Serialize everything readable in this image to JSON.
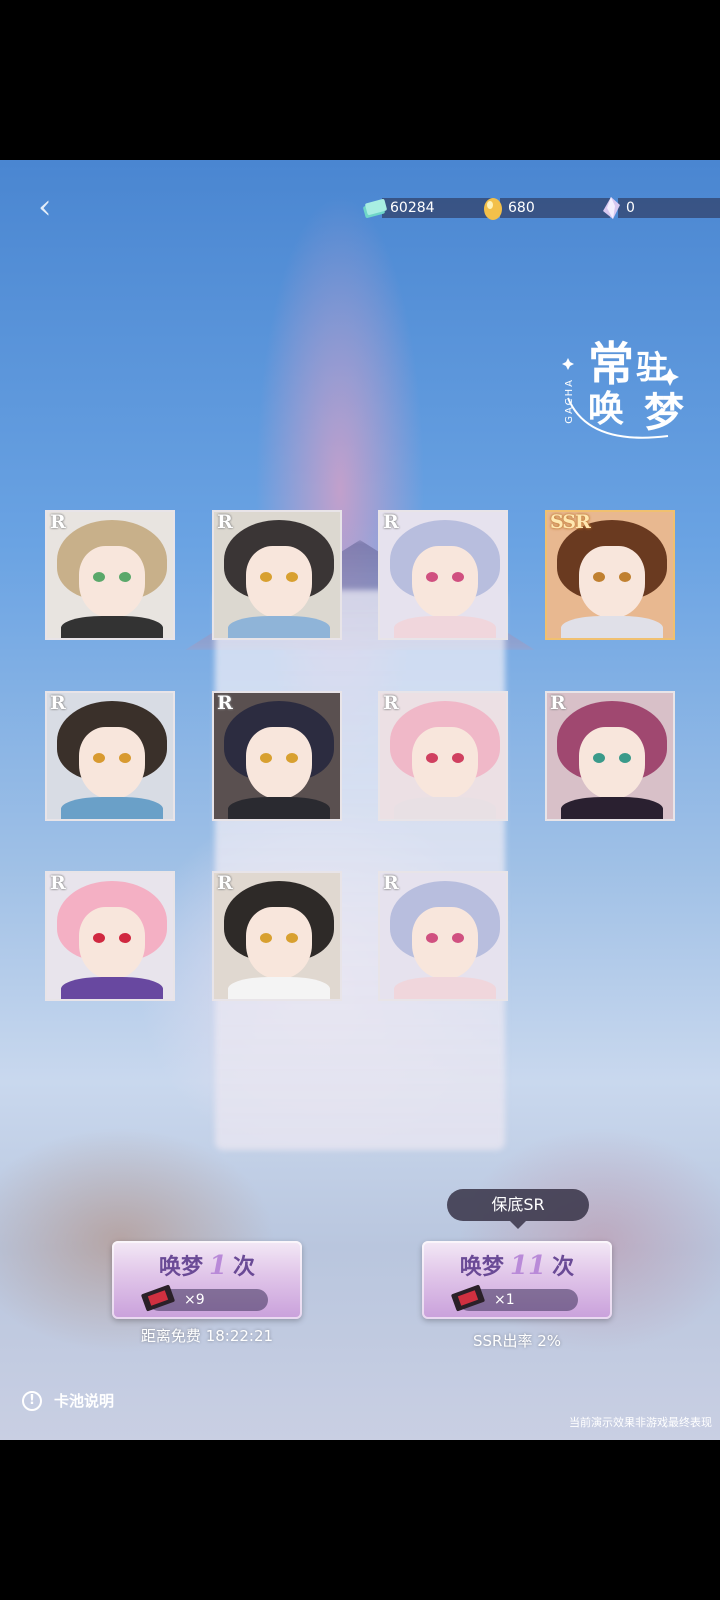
{
  "currencies": [
    {
      "icon": "ticket-stack-icon",
      "value": "60284",
      "color": "#6fd6c8"
    },
    {
      "icon": "gold-egg-icon",
      "value": "680",
      "color": "#f3c04a"
    },
    {
      "icon": "crystal-icon",
      "value": "0",
      "color": "#d8c8f0"
    }
  ],
  "banner": {
    "line1": "常",
    "line2": "驻",
    "line3": "唤",
    "line4": "梦",
    "tag": "GACHA"
  },
  "cards": [
    {
      "rarity": "R",
      "hair": "#c8b08a",
      "eye": "#5aa86a",
      "bg": "#e8e4e0",
      "body": "#333"
    },
    {
      "rarity": "R",
      "hair": "#3a3535",
      "eye": "#d8a030",
      "bg": "#dcd8d0",
      "body": "#8fb4d8"
    },
    {
      "rarity": "R",
      "hair": "#b8bede",
      "eye": "#d05080",
      "bg": "#e6e2ee",
      "body": "#f0d6dc"
    },
    {
      "rarity": "SSR",
      "hair": "#6a3a20",
      "eye": "#c08030",
      "bg": "#e8b890",
      "body": "#e0e0e8"
    },
    {
      "rarity": "R",
      "hair": "#3a302a",
      "eye": "#d89a30",
      "bg": "#d8dce4",
      "body": "#6aa0c8"
    },
    {
      "rarity": "R",
      "hair": "#2c2c40",
      "eye": "#d8a030",
      "bg": "#5a5050",
      "body": "#2a2a30"
    },
    {
      "rarity": "R",
      "hair": "#f0b8c8",
      "eye": "#d04060",
      "bg": "#ece0e4",
      "body": "#e8e0e4"
    },
    {
      "rarity": "R",
      "hair": "#a04870",
      "eye": "#3a9a8a",
      "bg": "#d8c0c8",
      "body": "#2a2030"
    },
    {
      "rarity": "R",
      "hair": "#f4b0c4",
      "eye": "#d02840",
      "bg": "#e8e4ec",
      "body": "#6848a0"
    },
    {
      "rarity": "R",
      "hair": "#2e2a28",
      "eye": "#d8a030",
      "bg": "#e0d8d0",
      "body": "#f4f4f4"
    },
    {
      "rarity": "R",
      "hair": "#b8bede",
      "eye": "#d05080",
      "bg": "#e6e2ee",
      "body": "#f0d6dc"
    }
  ],
  "pull_single": {
    "prefix": "唤梦",
    "count": "1",
    "suffix": "次",
    "tickets": "×9",
    "note": "距离免费 18:22:21"
  },
  "pull_multi": {
    "prefix": "唤梦",
    "count": "11",
    "suffix": "次",
    "tickets": "×1",
    "note": "SSR出率 2%",
    "tooltip": "保底SR"
  },
  "footer": {
    "info_label": "卡池说明",
    "disclaimer": "当前演示效果非游戏最终表现"
  }
}
